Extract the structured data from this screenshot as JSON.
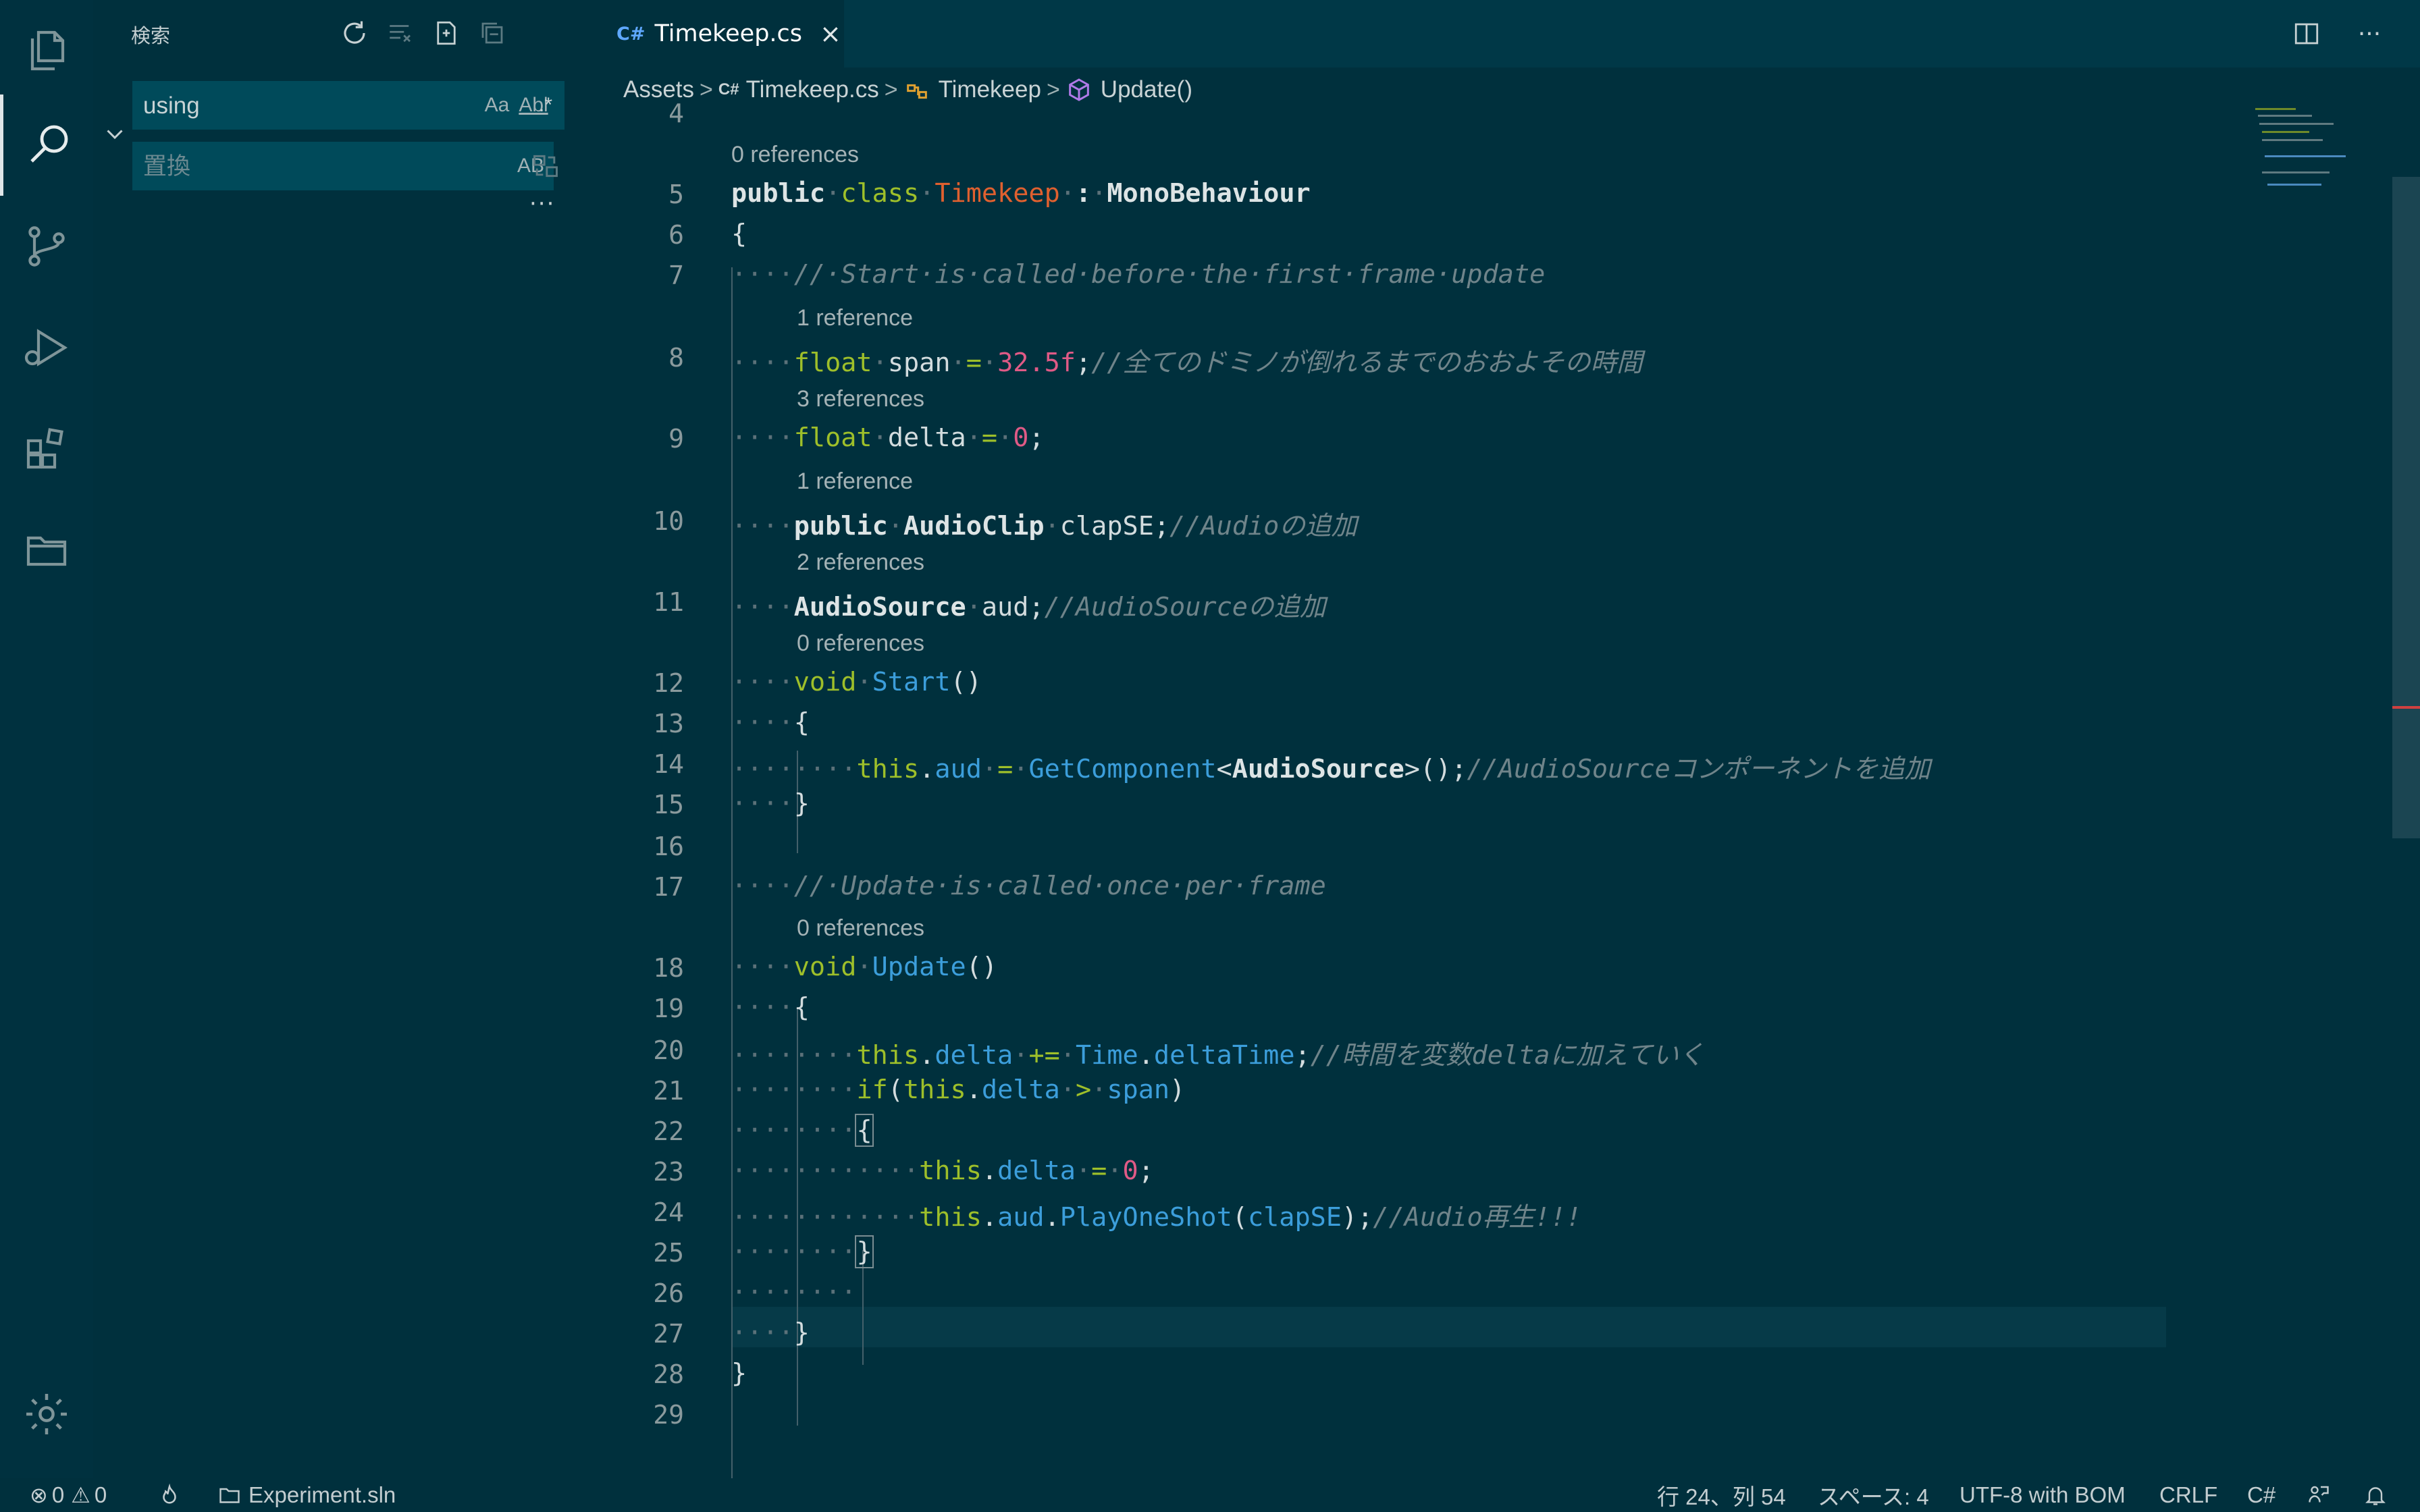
{
  "sidebar": {
    "title": "検索",
    "search": {
      "value": "using",
      "placeholder": "using",
      "opt_case": "Aa",
      "opt_word": "Abl",
      "opt_regex": ".*"
    },
    "replace": {
      "placeholder": "置換",
      "opt_preserve": "AB"
    },
    "more": "···"
  },
  "tab": {
    "icon": "C#",
    "name": "Timekeep.cs",
    "close": "×"
  },
  "editor_actions": {
    "more": "···"
  },
  "breadcrumb": {
    "items": [
      "Assets",
      "Timekeep.cs",
      "Timekeep",
      "Update()"
    ],
    "sep": ">"
  },
  "code": {
    "lines": {
      "l4": "4",
      "l5": "5",
      "l6": "6",
      "l7": "7",
      "l8": "8",
      "l9": "9",
      "l10": "10",
      "l11": "11",
      "l12": "12",
      "l13": "13",
      "l14": "14",
      "l15": "15",
      "l16": "16",
      "l17": "17",
      "l18": "18",
      "l19": "19",
      "l20": "20",
      "l21": "21",
      "l22": "22",
      "l23": "23",
      "l24": "24",
      "l25": "25",
      "l26": "26",
      "l27": "27",
      "l28": "28",
      "l29": "29"
    },
    "lens": {
      "c5": "0 references",
      "c8": "1 reference",
      "c9": "3 references",
      "c10": "1 reference",
      "c11": "2 references",
      "c12": "0 references",
      "c18": "0 references"
    },
    "tokens": {
      "public": "public",
      "class": "class",
      "Timekeep": "Timekeep",
      "colon": ":",
      "MonoBehaviour": "MonoBehaviour",
      "lbrace": "{",
      "rbrace": "}",
      "cm7": "//·Start·is·called·before·the·first·frame·update",
      "float": "float",
      "span": "span",
      "eq": "=",
      "num325": "32.5f",
      "semi": ";",
      "cm8": "//全てのドミノが倒れるまでのおおよその時間",
      "delta": "delta",
      "zero": "0",
      "AudioClip": "AudioClip",
      "clapSE": "clapSE",
      "cm10": "//Audioの追加",
      "AudioSource": "AudioSource",
      "aud": "aud",
      "cm11": "//AudioSourceの追加",
      "void": "void",
      "Start": "Start",
      "parens": "()",
      "this": "this",
      "dot": ".",
      "GetComponent": "GetComponent",
      "lt": "<",
      "gt": ">",
      "callend": "();",
      "cm14": "//AudioSourceコンポーネントを追加",
      "cm17": "//·Update·is·called·once·per·frame",
      "Update": "Update",
      "pluseq": "+=",
      "Time": "Time",
      "deltaTime": "deltaTime",
      "cm20": "//時間を変数deltaに加えていく",
      "if": "if",
      "lparen": "(",
      "rparen": ")",
      "gtop": ">",
      "PlayOneShot": "PlayOneShot",
      "cm24": "//Audio再生!!!"
    }
  },
  "status": {
    "errors": "0",
    "warnings": "0",
    "solution": "Experiment.sln",
    "position": "行 24、列 54",
    "spaces": "スペース: 4",
    "encoding": "UTF-8 with BOM",
    "eol": "CRLF",
    "language": "C#"
  }
}
